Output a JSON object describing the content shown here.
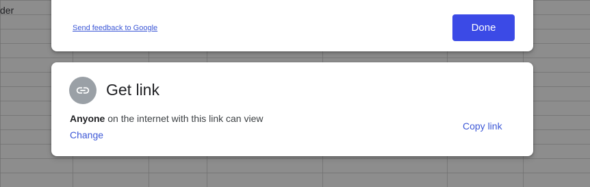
{
  "background": {
    "cell_text": "der"
  },
  "top_card": {
    "feedback_link": "Send feedback to Google",
    "done_label": "Done"
  },
  "get_link": {
    "icon": "link-icon",
    "title": "Get link",
    "access_scope": "Anyone",
    "access_rest": " on the internet with this link can view",
    "change_label": "Change",
    "copy_label": "Copy link"
  },
  "colors": {
    "accent": "#3b4ae6",
    "link": "#3c57d6",
    "icon_circle": "#9aa0a6"
  }
}
